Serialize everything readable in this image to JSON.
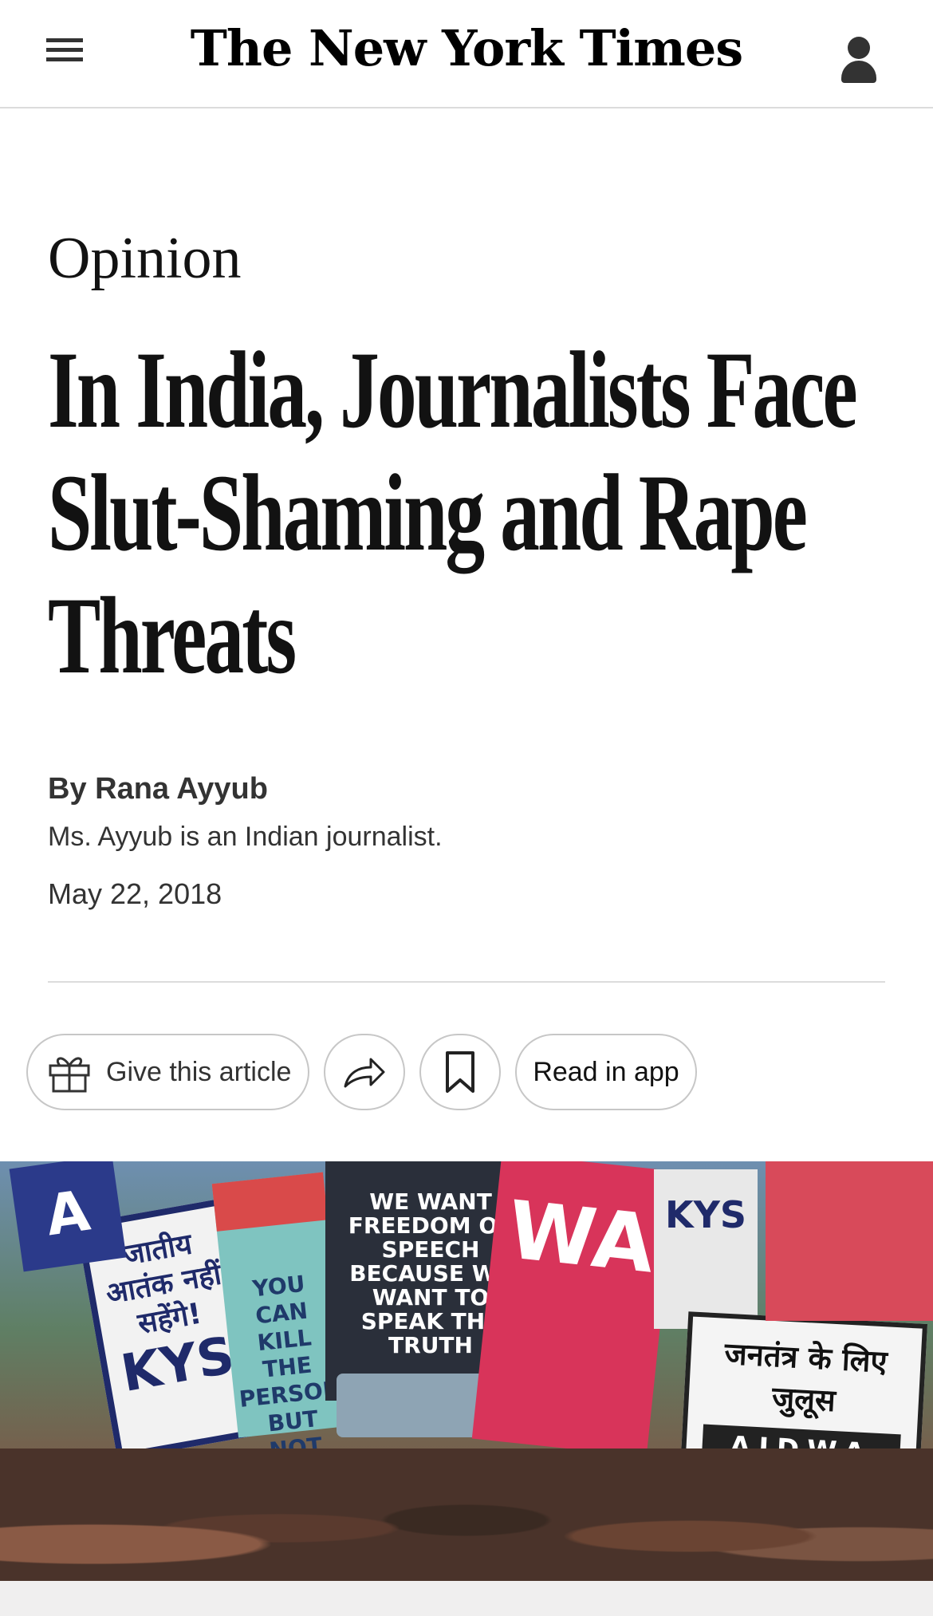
{
  "header": {
    "logo": "The New York Times",
    "menu_icon": "hamburger-menu-icon",
    "account_icon": "account-icon"
  },
  "article": {
    "kicker": "Opinion",
    "headline": "In India, Journalists Face Slut-Shaming and Rape Threats",
    "byline": "By Rana Ayyub",
    "bio": "Ms. Ayyub is an Indian journalist.",
    "date": "May 22, 2018"
  },
  "actions": {
    "gift_label": "Give this article",
    "gift_icon": "gift-icon",
    "share_icon": "share-icon",
    "save_icon": "bookmark-icon",
    "read_in_app_label": "Read in app"
  },
  "hero": {
    "sign_1": "WE WANT FREEDOM OF SPEECH BECAUSE WE WANT TO SPEAK THE TRUTH",
    "sign_2": "जनतंत्र के लिए जुलूस",
    "sign_2_org": "AIDWA",
    "sign_3": "जातीय आतंक नहीं सहेंगे!",
    "sign_3_org": "KYS",
    "sign_4": "YOU CAN KILL THE PERSON BUT NOT THE IDEA",
    "sign_5": "KYS",
    "sign_6": "WA",
    "sign_7": "A"
  }
}
